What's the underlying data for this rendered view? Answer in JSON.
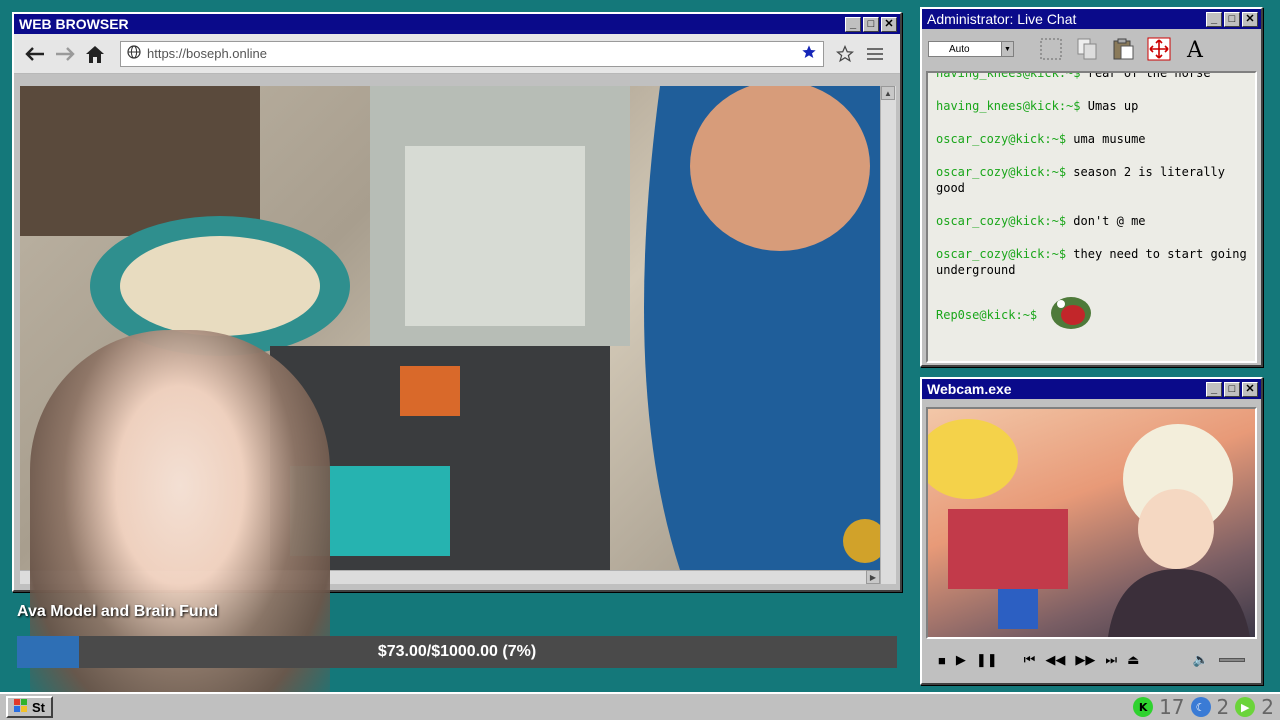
{
  "browser": {
    "title": "WEB BROWSER",
    "url": "https://boseph.online"
  },
  "chat": {
    "title": "Administrator: Live Chat",
    "font_select": "Auto",
    "messages": [
      {
        "user": "having_knees@kick:~$",
        "text": "rear of the horse"
      },
      {
        "user": "having_knees@kick:~$",
        "text": "Umas up"
      },
      {
        "user": "oscar_cozy@kick:~$",
        "text": "uma musume"
      },
      {
        "user": "oscar_cozy@kick:~$",
        "text": "season 2 is literally good"
      },
      {
        "user": "oscar_cozy@kick:~$",
        "text": "don't @ me"
      },
      {
        "user": "oscar_cozy@kick:~$",
        "text": "they need to start going underground"
      },
      {
        "user": "Rep0se@kick:~$",
        "text": ""
      }
    ],
    "user_color": "#1aa61a"
  },
  "webcam": {
    "title": "Webcam.exe"
  },
  "fund": {
    "title": "Ava Model and Brain Fund",
    "progress_text": "$73.00/$1000.00 (7%)",
    "fraction": 0.07,
    "fill_color": "#2e6fb5"
  },
  "taskbar": {
    "start_label": "St",
    "tray": [
      {
        "icon": "kick-icon",
        "value": "17",
        "color": "#2fd22f"
      },
      {
        "icon": "moon-icon",
        "value": "2",
        "color": "#3a7bd5"
      },
      {
        "icon": "play-icon",
        "value": "2",
        "color": "#6bd43a"
      }
    ]
  }
}
